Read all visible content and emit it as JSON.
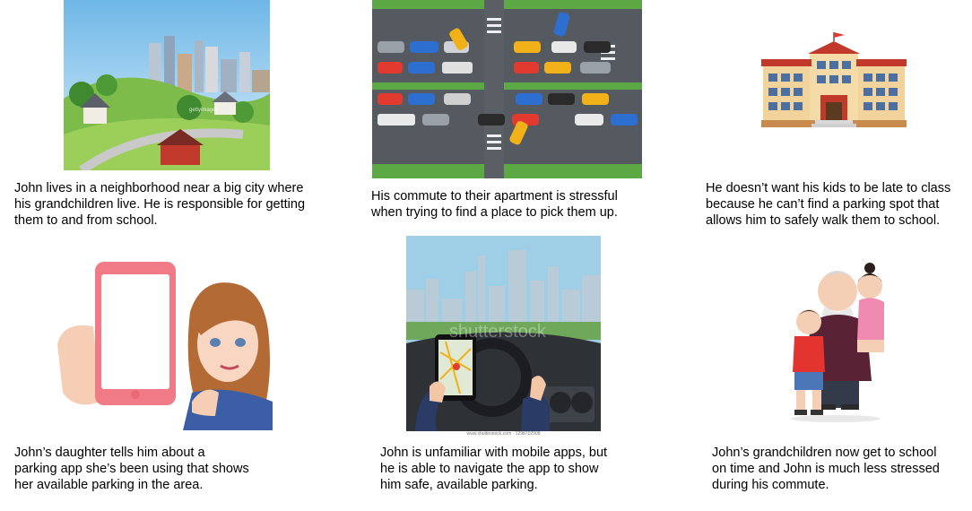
{
  "panels": [
    {
      "caption": "John lives in a neighborhood near a big city where\nhis grandchildren live. He is responsible for getting\nthem to and from school.",
      "image": "suburb-city-illustration",
      "watermark": "gettyimages"
    },
    {
      "caption": "His commute to their apartment is stressful\nwhen trying to find a place to pick them up.",
      "image": "traffic-jam-top-view"
    },
    {
      "caption": "He doesn’t want his kids to be late to class\nbecause he can’t find a parking spot that\nallows him to safely walk them to school.",
      "image": "school-building"
    },
    {
      "caption": "John’s daughter tells him about a\nparking app she’s been using that shows\nher available parking in the area.",
      "image": "woman-holding-phone"
    },
    {
      "caption": "John is unfamiliar with mobile apps, but\nhe is able to navigate the app to show\nhim safe, available parking.",
      "image": "driver-using-map-app",
      "watermark": "shutterstock",
      "footer": "www.shutterstock.com · 1298702908"
    },
    {
      "caption": "John’s grandchildren now get to school\non time and John is much less stressed\nduring his commute.",
      "image": "grandfather-with-grandchildren"
    }
  ]
}
